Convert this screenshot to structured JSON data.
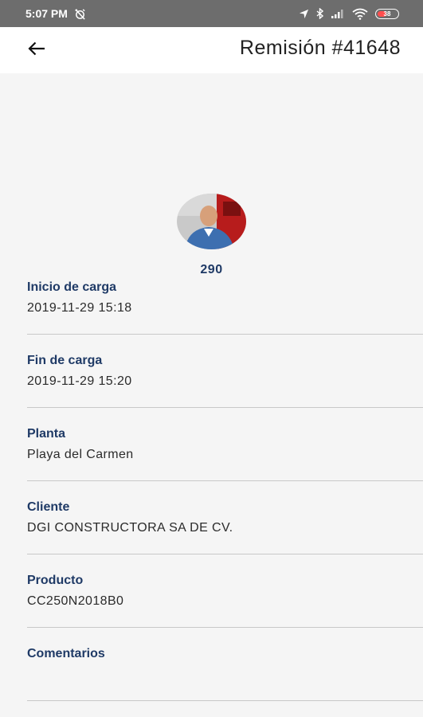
{
  "status_bar": {
    "time": "5:07 PM",
    "battery_level": "38",
    "icons": [
      "alarm-off-icon",
      "location-icon",
      "bluetooth-icon",
      "signal-icon",
      "wifi-icon",
      "battery-icon"
    ]
  },
  "header": {
    "back_icon": "arrow-left-icon",
    "title": "Remisión #41648"
  },
  "avatar": {
    "number": "290"
  },
  "fields": [
    {
      "label": "Inicio de carga",
      "value": "2019-11-29 15:18"
    },
    {
      "label": "Fin de carga",
      "value": "2019-11-29 15:20"
    },
    {
      "label": "Planta",
      "value": "Playa del Carmen"
    },
    {
      "label": "Cliente",
      "value": "DGI CONSTRUCTORA SA DE CV."
    },
    {
      "label": "Producto",
      "value": "CC250N2018B0"
    },
    {
      "label": "Comentarios",
      "value": ""
    }
  ],
  "colors": {
    "label": "#1f3a66",
    "background": "#f5f5f5",
    "status_bar": "#6d6d6d",
    "divider": "#c8c8c8"
  }
}
